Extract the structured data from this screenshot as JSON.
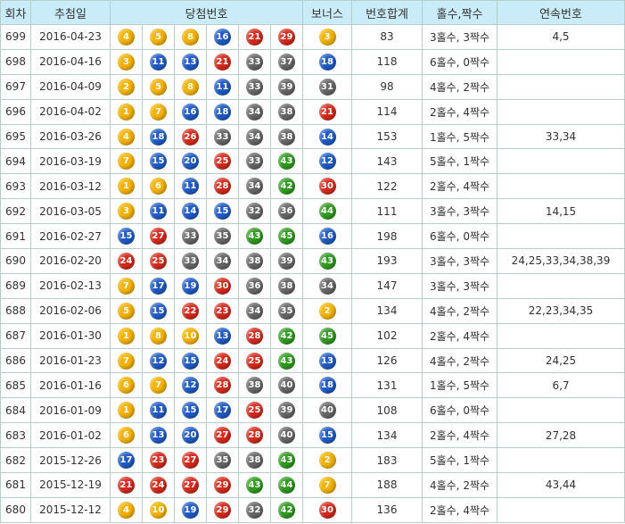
{
  "headers": {
    "round": "회차",
    "date": "추첨일",
    "winning": "당첨번호",
    "bonus": "보너스",
    "sum": "번호합계",
    "oddeven": "홀수,짝수",
    "consecutive": "연속번호"
  },
  "ball_colors": {
    "yellow": "#f4b200",
    "blue": "#1f5bc4",
    "red": "#d42a1c",
    "gray": "#666666",
    "green": "#2f9a1f"
  },
  "rows": [
    {
      "round": "699",
      "date": "2016-04-23",
      "nums": [
        "4",
        "5",
        "8",
        "16",
        "21",
        "29"
      ],
      "bonus": "3",
      "sum": "83",
      "oddeven": "3홀수, 3짝수",
      "consec": "4,5"
    },
    {
      "round": "698",
      "date": "2016-04-16",
      "nums": [
        "3",
        "11",
        "13",
        "21",
        "33",
        "37"
      ],
      "bonus": "18",
      "sum": "118",
      "oddeven": "6홀수, 0짝수",
      "consec": ""
    },
    {
      "round": "697",
      "date": "2016-04-09",
      "nums": [
        "2",
        "5",
        "8",
        "11",
        "33",
        "39"
      ],
      "bonus": "31",
      "sum": "98",
      "oddeven": "4홀수, 2짝수",
      "consec": ""
    },
    {
      "round": "696",
      "date": "2016-04-02",
      "nums": [
        "1",
        "7",
        "16",
        "18",
        "34",
        "38"
      ],
      "bonus": "21",
      "sum": "114",
      "oddeven": "2홀수, 4짝수",
      "consec": ""
    },
    {
      "round": "695",
      "date": "2016-03-26",
      "nums": [
        "4",
        "18",
        "26",
        "33",
        "34",
        "38"
      ],
      "bonus": "14",
      "sum": "153",
      "oddeven": "1홀수, 5짝수",
      "consec": "33,34"
    },
    {
      "round": "694",
      "date": "2016-03-19",
      "nums": [
        "7",
        "15",
        "20",
        "25",
        "33",
        "43"
      ],
      "bonus": "12",
      "sum": "143",
      "oddeven": "5홀수, 1짝수",
      "consec": ""
    },
    {
      "round": "693",
      "date": "2016-03-12",
      "nums": [
        "1",
        "6",
        "11",
        "28",
        "34",
        "42"
      ],
      "bonus": "30",
      "sum": "122",
      "oddeven": "2홀수, 4짝수",
      "consec": ""
    },
    {
      "round": "692",
      "date": "2016-03-05",
      "nums": [
        "3",
        "11",
        "14",
        "15",
        "32",
        "36"
      ],
      "bonus": "44",
      "sum": "111",
      "oddeven": "3홀수, 3짝수",
      "consec": "14,15"
    },
    {
      "round": "691",
      "date": "2016-02-27",
      "nums": [
        "15",
        "27",
        "33",
        "35",
        "43",
        "45"
      ],
      "bonus": "16",
      "sum": "198",
      "oddeven": "6홀수, 0짝수",
      "consec": ""
    },
    {
      "round": "690",
      "date": "2016-02-20",
      "nums": [
        "24",
        "25",
        "33",
        "34",
        "38",
        "39"
      ],
      "bonus": "43",
      "sum": "193",
      "oddeven": "3홀수, 3짝수",
      "consec": "24,25,33,34,38,39"
    },
    {
      "round": "689",
      "date": "2016-02-13",
      "nums": [
        "7",
        "17",
        "19",
        "30",
        "36",
        "38"
      ],
      "bonus": "34",
      "sum": "147",
      "oddeven": "3홀수, 3짝수",
      "consec": ""
    },
    {
      "round": "688",
      "date": "2016-02-06",
      "nums": [
        "5",
        "15",
        "22",
        "23",
        "34",
        "35"
      ],
      "bonus": "2",
      "sum": "134",
      "oddeven": "4홀수, 2짝수",
      "consec": "22,23,34,35"
    },
    {
      "round": "687",
      "date": "2016-01-30",
      "nums": [
        "1",
        "8",
        "10",
        "13",
        "28",
        "42"
      ],
      "bonus": "45",
      "sum": "102",
      "oddeven": "2홀수, 4짝수",
      "consec": ""
    },
    {
      "round": "686",
      "date": "2016-01-23",
      "nums": [
        "7",
        "12",
        "15",
        "24",
        "25",
        "43"
      ],
      "bonus": "13",
      "sum": "126",
      "oddeven": "4홀수, 2짝수",
      "consec": "24,25"
    },
    {
      "round": "685",
      "date": "2016-01-16",
      "nums": [
        "6",
        "7",
        "12",
        "28",
        "38",
        "40"
      ],
      "bonus": "18",
      "sum": "131",
      "oddeven": "1홀수, 5짝수",
      "consec": "6,7"
    },
    {
      "round": "684",
      "date": "2016-01-09",
      "nums": [
        "1",
        "11",
        "15",
        "17",
        "25",
        "39"
      ],
      "bonus": "40",
      "sum": "108",
      "oddeven": "6홀수, 0짝수",
      "consec": ""
    },
    {
      "round": "683",
      "date": "2016-01-02",
      "nums": [
        "6",
        "13",
        "20",
        "27",
        "28",
        "40"
      ],
      "bonus": "15",
      "sum": "134",
      "oddeven": "2홀수, 4짝수",
      "consec": "27,28"
    },
    {
      "round": "682",
      "date": "2015-12-26",
      "nums": [
        "17",
        "23",
        "27",
        "35",
        "38",
        "43"
      ],
      "bonus": "2",
      "sum": "183",
      "oddeven": "5홀수, 1짝수",
      "consec": ""
    },
    {
      "round": "681",
      "date": "2015-12-19",
      "nums": [
        "21",
        "24",
        "27",
        "29",
        "43",
        "44"
      ],
      "bonus": "7",
      "sum": "188",
      "oddeven": "4홀수, 2짝수",
      "consec": "43,44"
    },
    {
      "round": "680",
      "date": "2015-12-12",
      "nums": [
        "4",
        "10",
        "19",
        "29",
        "32",
        "42"
      ],
      "bonus": "30",
      "sum": "136",
      "oddeven": "2홀수, 4짝수",
      "consec": ""
    }
  ]
}
